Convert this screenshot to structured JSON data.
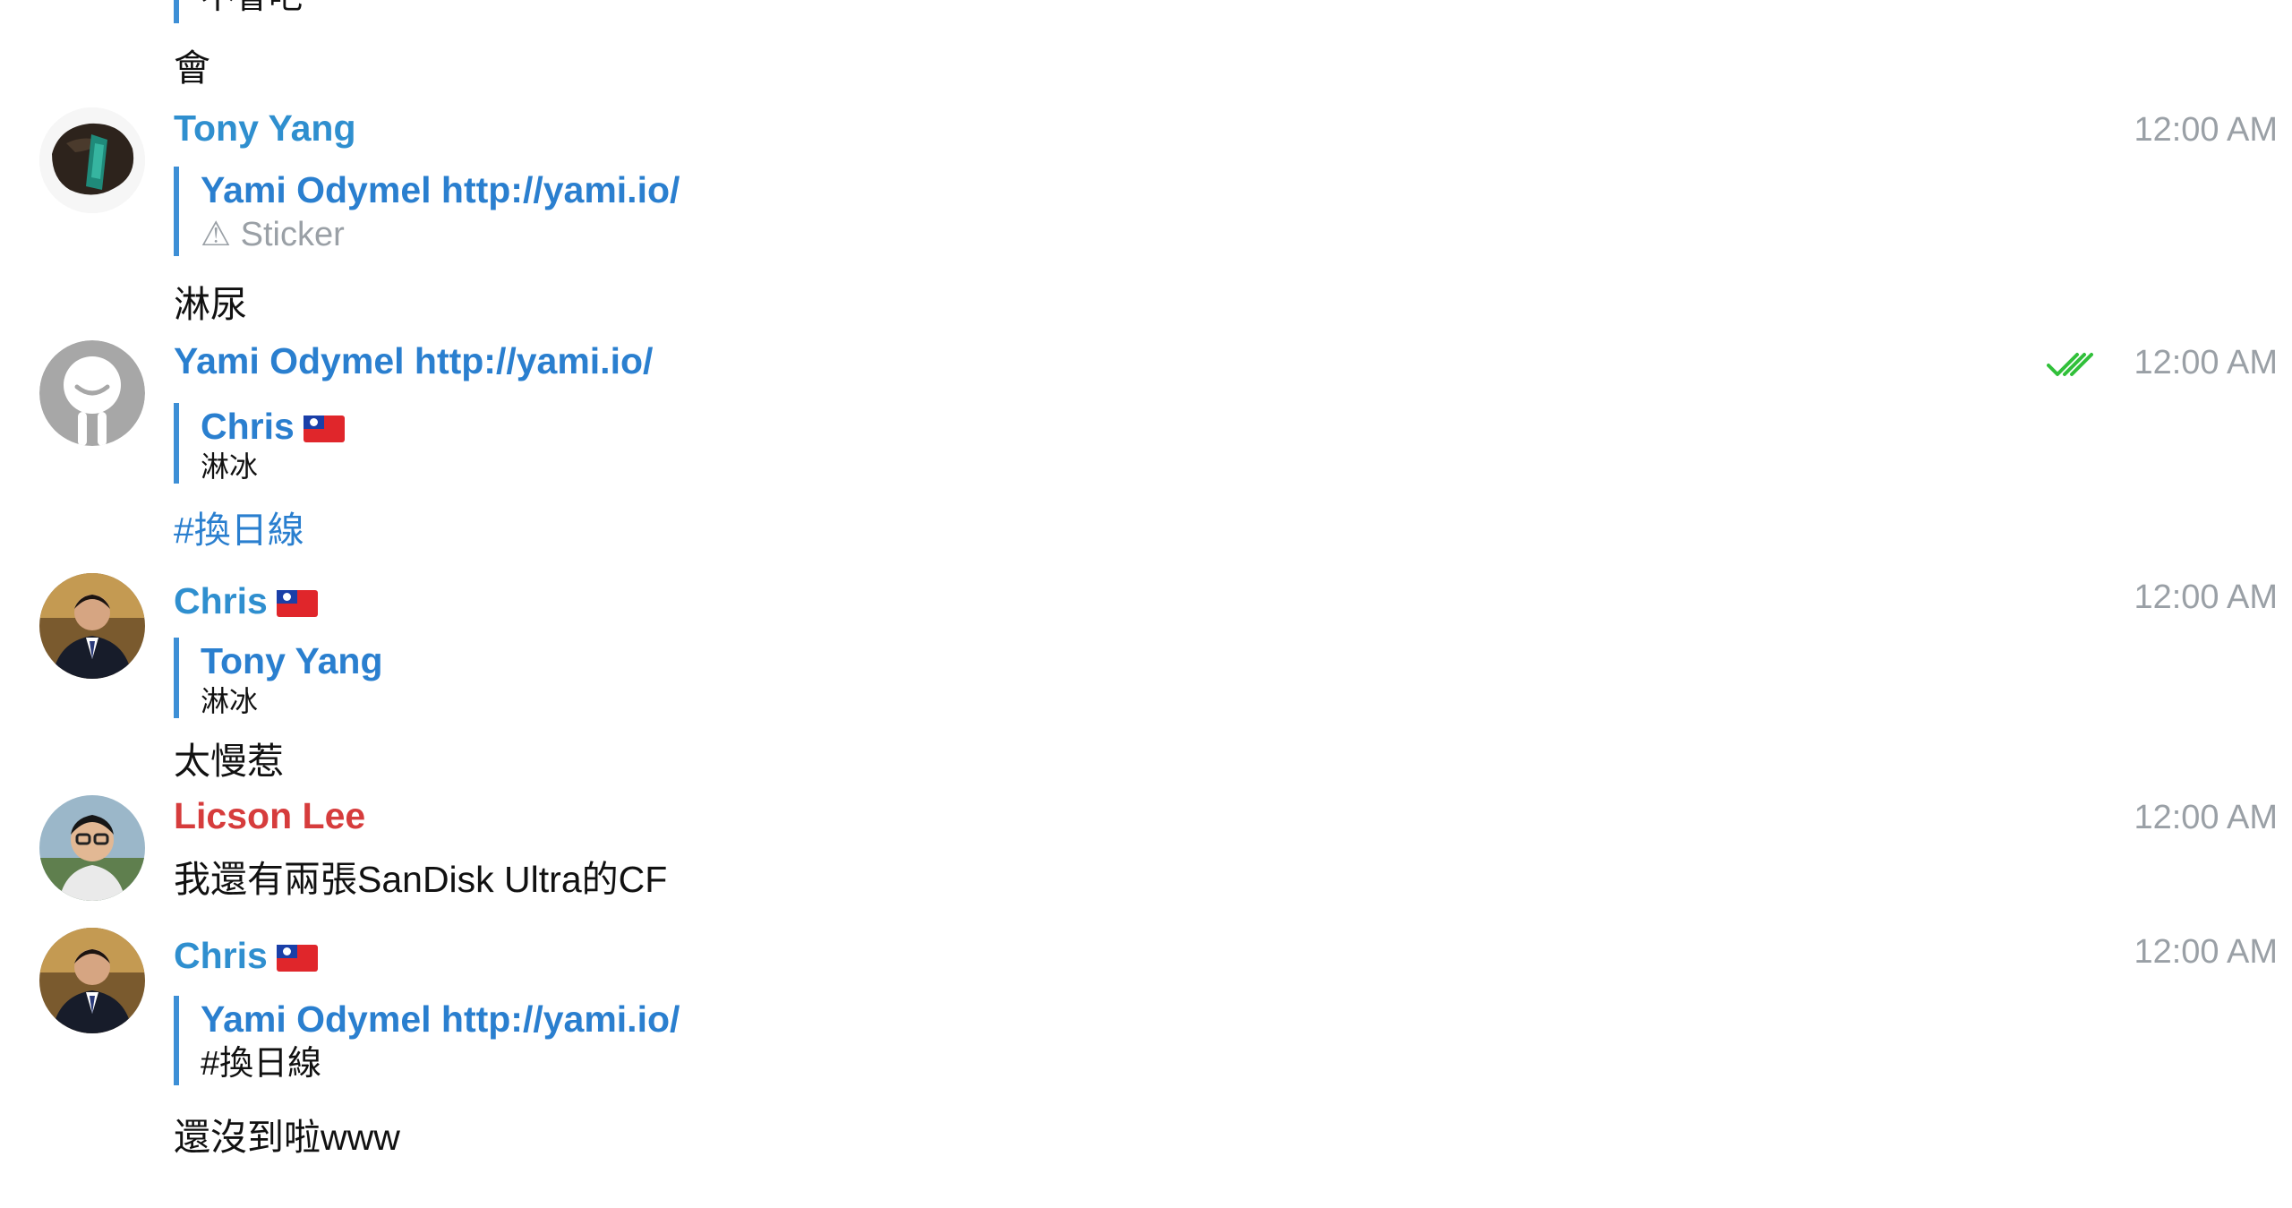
{
  "messages": [
    {
      "id": "m0",
      "quote_text": "不會吧",
      "text": "會"
    },
    {
      "id": "m1",
      "sender": "Tony Yang",
      "time": "12:00 AM",
      "quote": {
        "name": "Yami Odymel http://yami.io/",
        "text": "⚠ Sticker"
      },
      "text": "淋尿"
    },
    {
      "id": "m2",
      "sender": "Yami Odymel http://yami.io/",
      "time": "12:00 AM",
      "status": "read",
      "quote": {
        "name": "Chris",
        "text": "淋冰"
      },
      "text": "#換日線"
    },
    {
      "id": "m3",
      "sender": "Chris",
      "time": "12:00 AM",
      "quote": {
        "name": "Tony Yang",
        "text": "淋冰"
      },
      "text": "太慢惹"
    },
    {
      "id": "m4",
      "sender": "Licson Lee",
      "time": "12:00 AM",
      "text": "我還有兩張SanDisk Ultra的CF"
    },
    {
      "id": "m5",
      "sender": "Chris",
      "time": "12:00 AM",
      "quote": {
        "name": "Yami Odymel http://yami.io/",
        "text": "#換日線"
      },
      "text": "還沒到啦www"
    }
  ],
  "colors": {
    "sender_blue": "#2f8fcf",
    "sender_red": "#d63c3c",
    "quote_bar": "#3d8fd6",
    "read_check": "#31c03a",
    "timestamp": "#9aa0a6"
  },
  "icons": {
    "flag": "taiwan-flag-icon",
    "read_receipt": "double-check-icon",
    "warning": "warning-icon"
  }
}
